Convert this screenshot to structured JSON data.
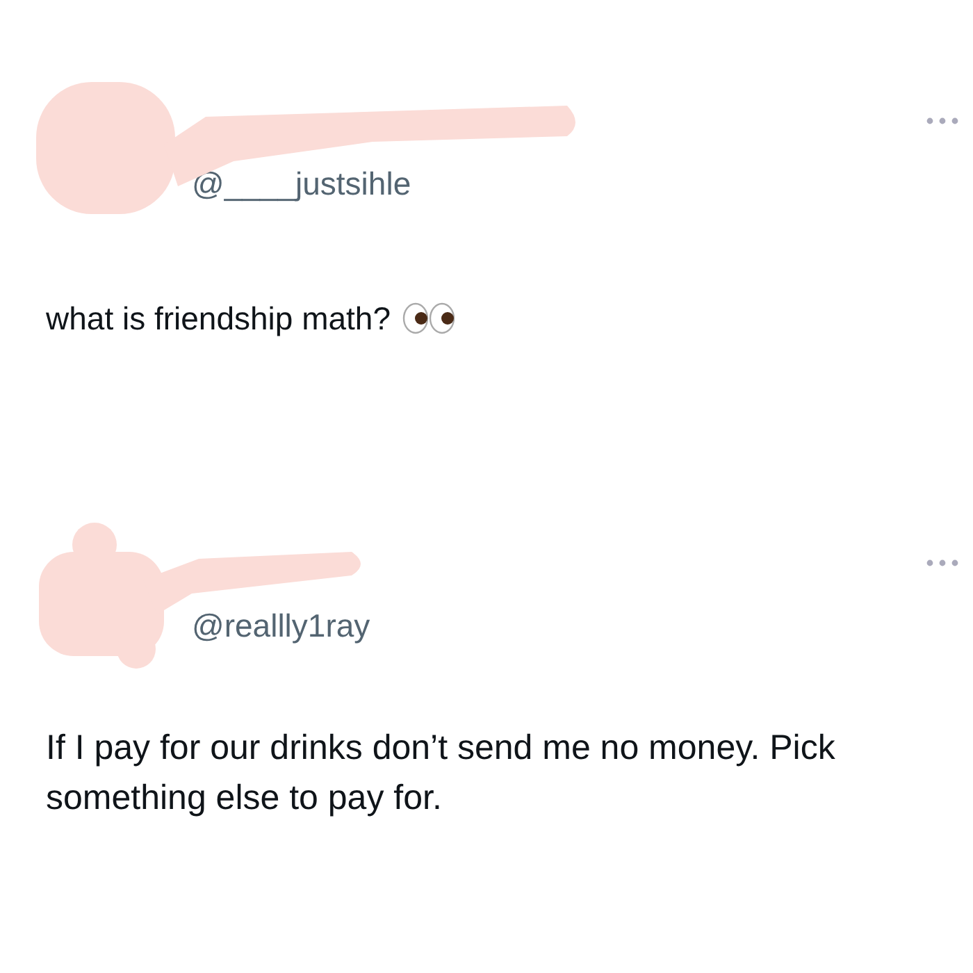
{
  "posts": [
    {
      "handle": "@____justsihle",
      "text": "what is friendship math?",
      "eyes_emoji": true
    },
    {
      "handle": "@reallly1ray",
      "text": "If I pay for our drinks don’t send me no money. Pick something else to pay for."
    }
  ]
}
